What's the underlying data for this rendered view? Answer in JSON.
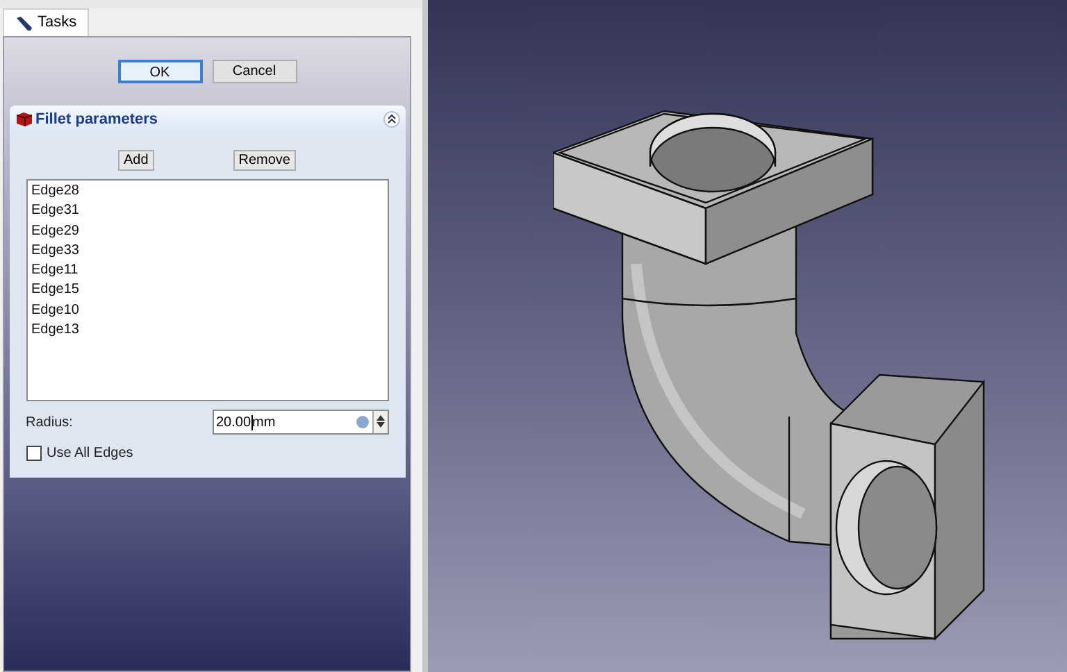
{
  "tabs": [
    {
      "label": "Tasks",
      "selected": true
    }
  ],
  "buttons": [
    {
      "label": "OK",
      "selected": true
    },
    {
      "label": "Cancel",
      "selected": false
    }
  ],
  "fillet_panel": {
    "title": "Fillet parameters",
    "add_button": "Add",
    "remove_button": "Remove",
    "edges": [
      "Edge28",
      "Edge31",
      "Edge29",
      "Edge33",
      "Edge11",
      "Edge15",
      "Edge10",
      "Edge13"
    ],
    "radius_label": "Radius:",
    "radius_value": "20.00",
    "radius_unit": "mm",
    "use_all_edges": {
      "label": "Use All Edges",
      "checked": false
    }
  }
}
